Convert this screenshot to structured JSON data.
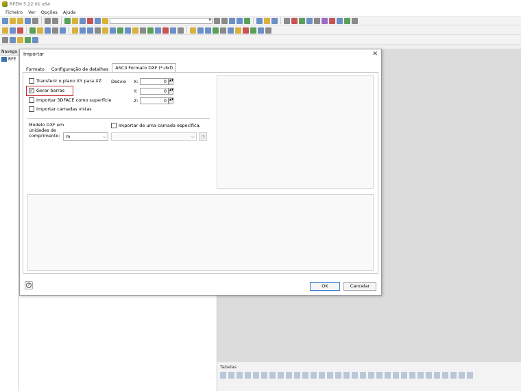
{
  "app": {
    "title": "RFEM 5.22.01 x64"
  },
  "menu": [
    "Ficheiro",
    "Ver",
    "Opções",
    "Ajuda"
  ],
  "nav": {
    "header": "Navega",
    "root_item": "RFE"
  },
  "tables_panel": {
    "title": "Tabelas"
  },
  "dialog": {
    "title": "Importar",
    "close": "✕",
    "tabs": [
      "Formato",
      "Configuração de detalhes",
      "ASCII Formato DXF (*.dxf)"
    ],
    "options": {
      "transfer_plane": {
        "label": "Transferir o plano XY para XZ",
        "checked": false
      },
      "gerar_barras": {
        "label": "Gerar barras",
        "checked": true
      },
      "import_3dface": {
        "label": "Importar 3DFACE como superfície",
        "checked": false
      },
      "import_layers": {
        "label": "Importar camadas vistas",
        "checked": false
      }
    },
    "offset": {
      "label": "Desvio",
      "x_label": "X:",
      "x_value": "0",
      "y_label": "Y:",
      "y_value": "0",
      "z_label": "Z:",
      "z_value": "0"
    },
    "units": {
      "label_1": "Modelo DXF em",
      "label_2": "unidades de",
      "label_3": "comprimento:",
      "value": "m"
    },
    "specific_layer": {
      "label": "Importar de uma camada específica:",
      "checked": false,
      "value": ""
    },
    "buttons": {
      "ok": "OK",
      "cancel": "Cancelar"
    }
  },
  "colors": {
    "highlight": "#c4262e",
    "ok_border": "#3b7fd5"
  }
}
